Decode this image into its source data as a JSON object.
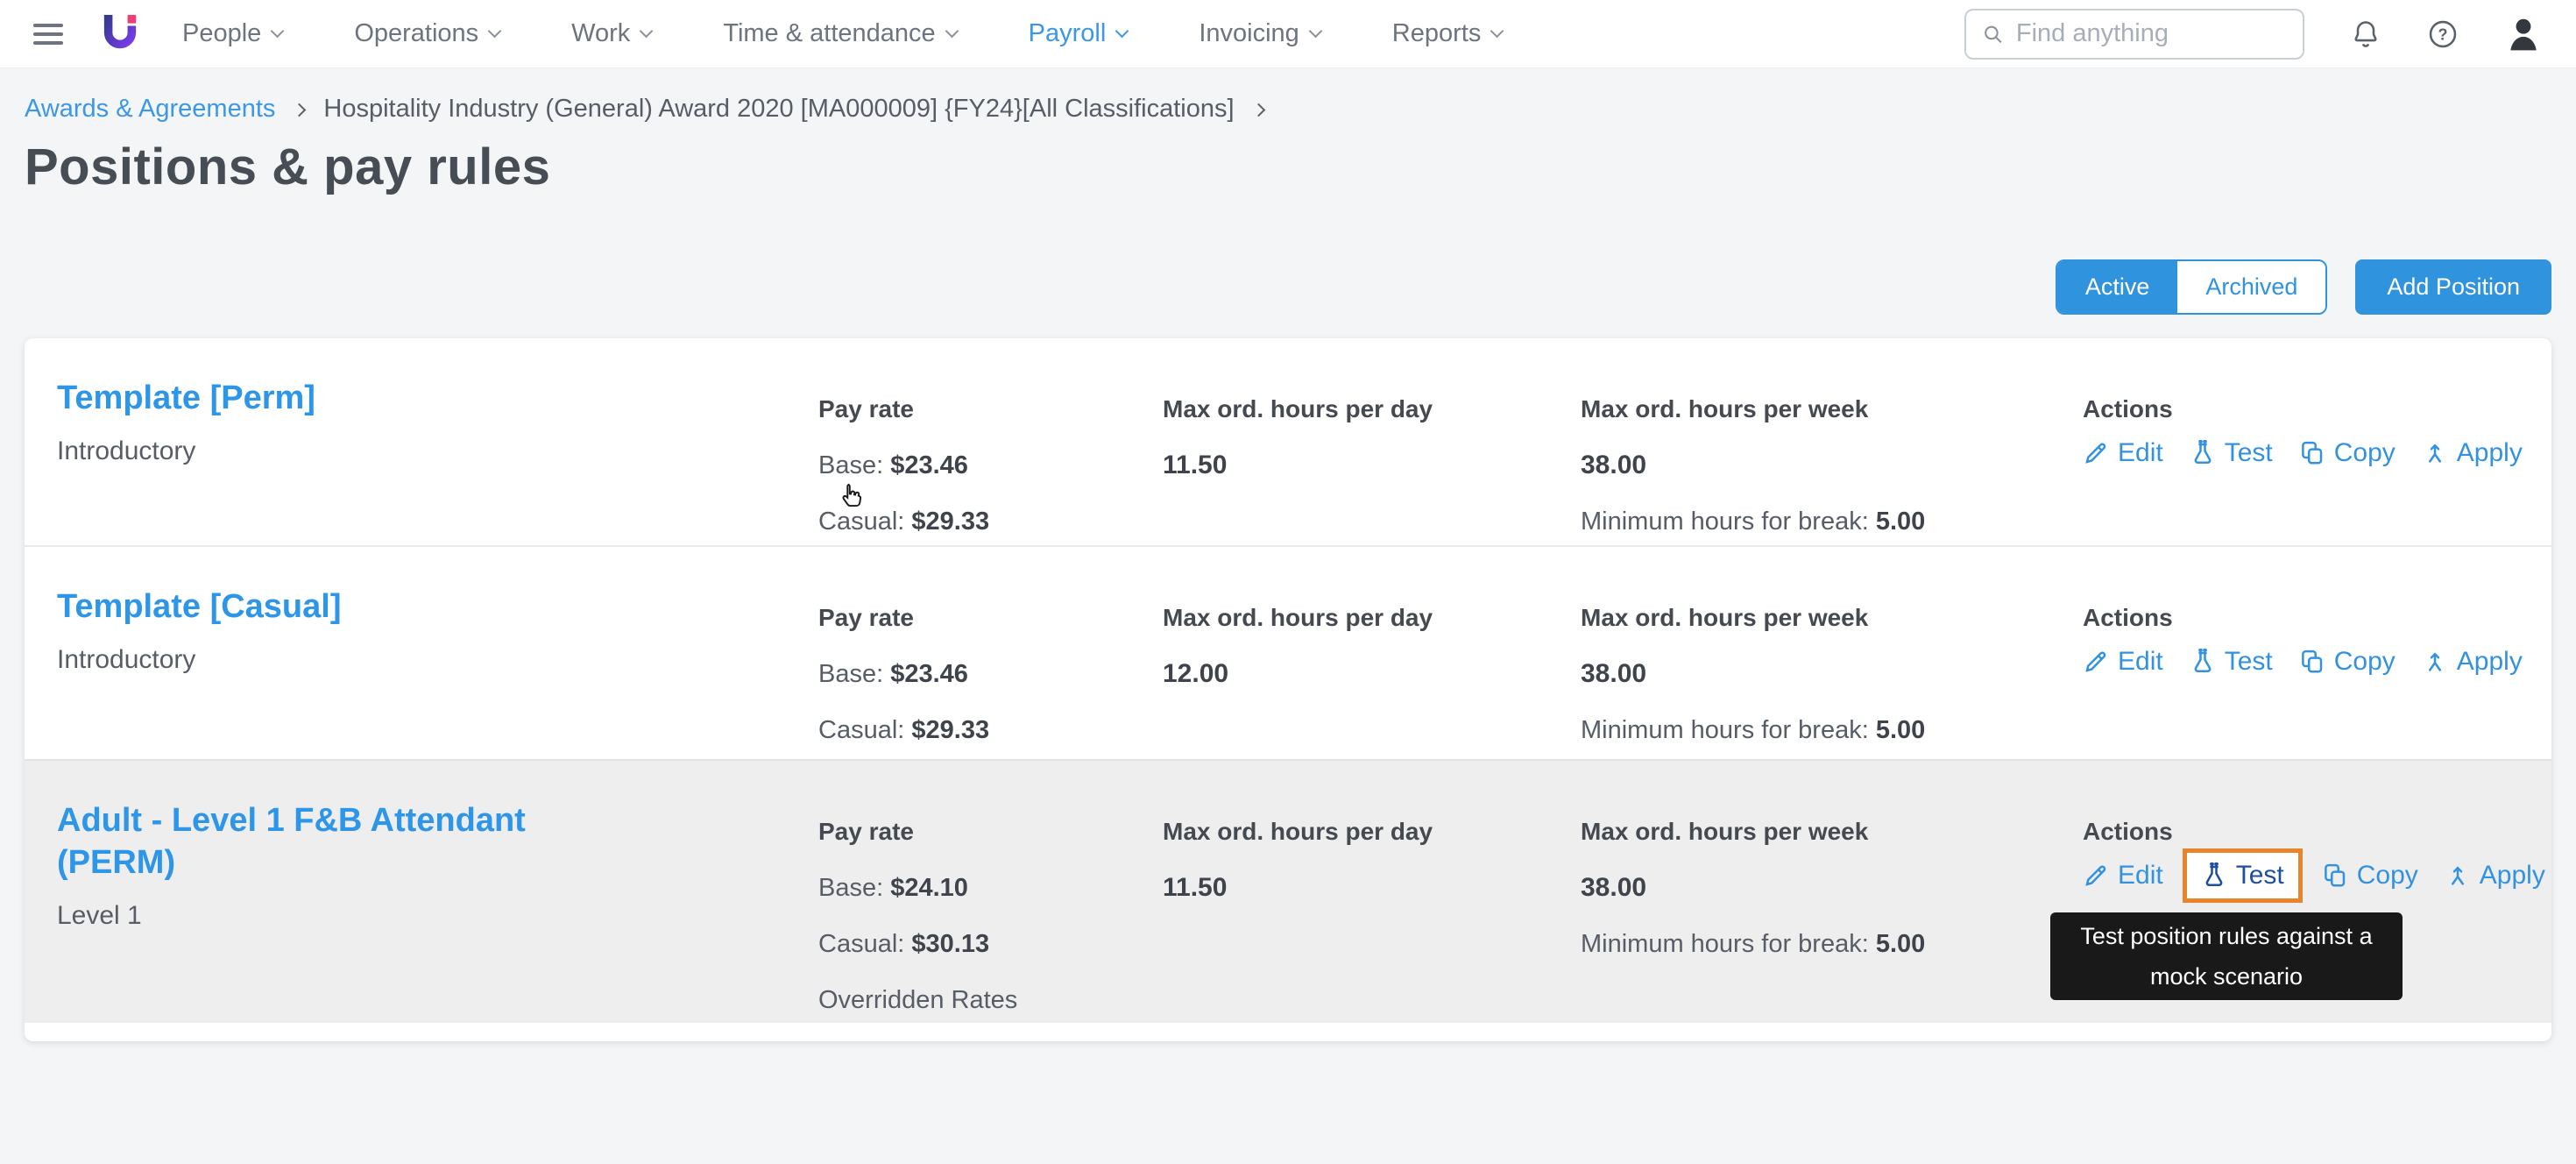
{
  "nav": {
    "items": [
      "People",
      "Operations",
      "Work",
      "Time & attendance",
      "Payroll",
      "Invoicing",
      "Reports"
    ],
    "active_item": "Payroll",
    "search_placeholder": "Find anything"
  },
  "breadcrumb": {
    "link": "Awards & Agreements",
    "current": "Hospitality Industry (General) Award 2020 [MA000009] {FY24}[All Classifications]"
  },
  "page": {
    "title": "Positions & pay rules"
  },
  "controls": {
    "toggle_active": "Active",
    "toggle_archived": "Archived",
    "selected_toggle": "Active",
    "add_button": "Add Position"
  },
  "table": {
    "labels": {
      "pay_rate": "Pay rate",
      "base": "Base:",
      "casual": "Casual:",
      "max_day": "Max ord. hours per day",
      "max_week": "Max ord. hours per week",
      "min_break": "Minimum hours for break:",
      "actions": "Actions"
    },
    "action_labels": {
      "edit": "Edit",
      "test": "Test",
      "copy": "Copy",
      "apply": "Apply"
    },
    "rows": [
      {
        "name": "Template [Perm]",
        "classification": "Introductory",
        "base": "$23.46",
        "casual": "$29.33",
        "max_day": "11.50",
        "max_week": "38.00",
        "min_break": "5.00"
      },
      {
        "name": "Template [Casual]",
        "classification": "Introductory",
        "base": "$23.46",
        "casual": "$29.33",
        "max_day": "12.00",
        "max_week": "38.00",
        "min_break": "5.00"
      },
      {
        "name": "Adult - Level 1 F&B Attendant (PERM)",
        "classification": "Level 1",
        "base": "$24.10",
        "casual": "$30.13",
        "max_day": "11.50",
        "max_week": "38.00",
        "min_break": "5.00",
        "overridden": "Overridden Rates"
      }
    ]
  },
  "tooltip": {
    "line1": "Test position rules against a",
    "line2": "mock scenario"
  },
  "colors": {
    "accent_blue": "#2f93dd",
    "link_blue": "#3392e0",
    "title_blue": "#2e96e8",
    "nav_active_blue": "#3b97e8",
    "highlight_orange": "#e8852c",
    "tooltip_bg": "#191919",
    "row_highlight_bg": "#eeeeef",
    "logo_gradient_start": "#343a8f",
    "logo_gradient_end": "#7a3bec",
    "logo_dot_pink": "#f23c77"
  }
}
